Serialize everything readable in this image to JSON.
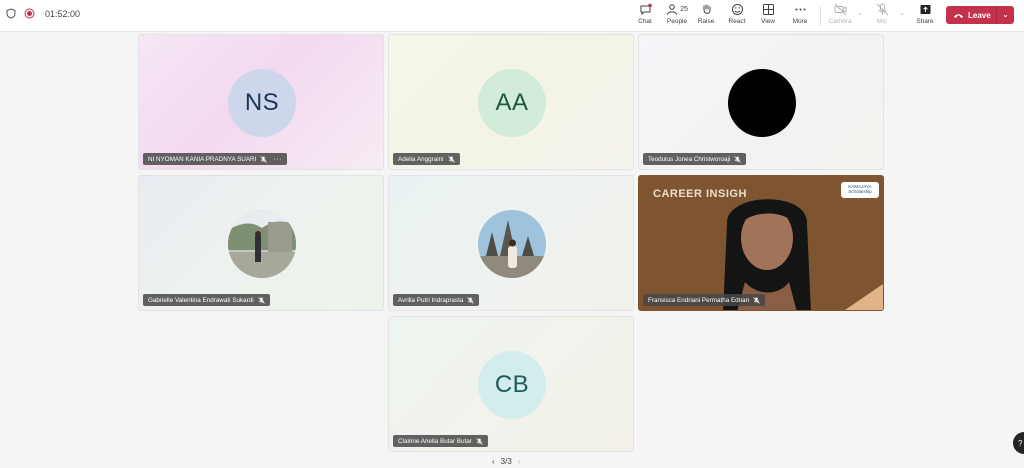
{
  "meeting": {
    "timer": "01:52:00"
  },
  "toolbar": {
    "chat": "Chat",
    "people": "People",
    "people_count": "25",
    "raise": "Raise",
    "react": "React",
    "view": "View",
    "more": "More",
    "camera": "Camera",
    "mic": "Mic",
    "share": "Share",
    "leave": "Leave"
  },
  "tiles": [
    {
      "initials": "NS",
      "name": "NI NYOMAN KANIA PRADNYA SUARI",
      "more": "···"
    },
    {
      "initials": "AA",
      "name": "Adelia Anggraini"
    },
    {
      "name": "Teodulus Jonea Christworoaji"
    },
    {
      "name": "Gabrielle Valentina Endrawati Sukardi"
    },
    {
      "name": "Avrilla Putri Indraprasta"
    },
    {
      "name": "Fransisca Endriani Permatha Ednan",
      "banner": "CAREER INSIGH",
      "logo_text": "KAMAJAYA Scholarship"
    },
    {
      "initials": "CB",
      "name": "Clairine Ariella Butar Butar"
    }
  ],
  "pager": {
    "prev": "‹",
    "text": "3/3",
    "next": "›"
  },
  "colors": {
    "leave": "#c4314b",
    "accent": "#6264a7"
  },
  "icons": [
    "shield-icon",
    "record-icon",
    "chat-icon",
    "people-icon",
    "raise-hand-icon",
    "react-icon",
    "view-icon",
    "more-icon",
    "camera-icon",
    "mic-icon",
    "share-icon",
    "phone-icon",
    "mic-off-icon"
  ]
}
